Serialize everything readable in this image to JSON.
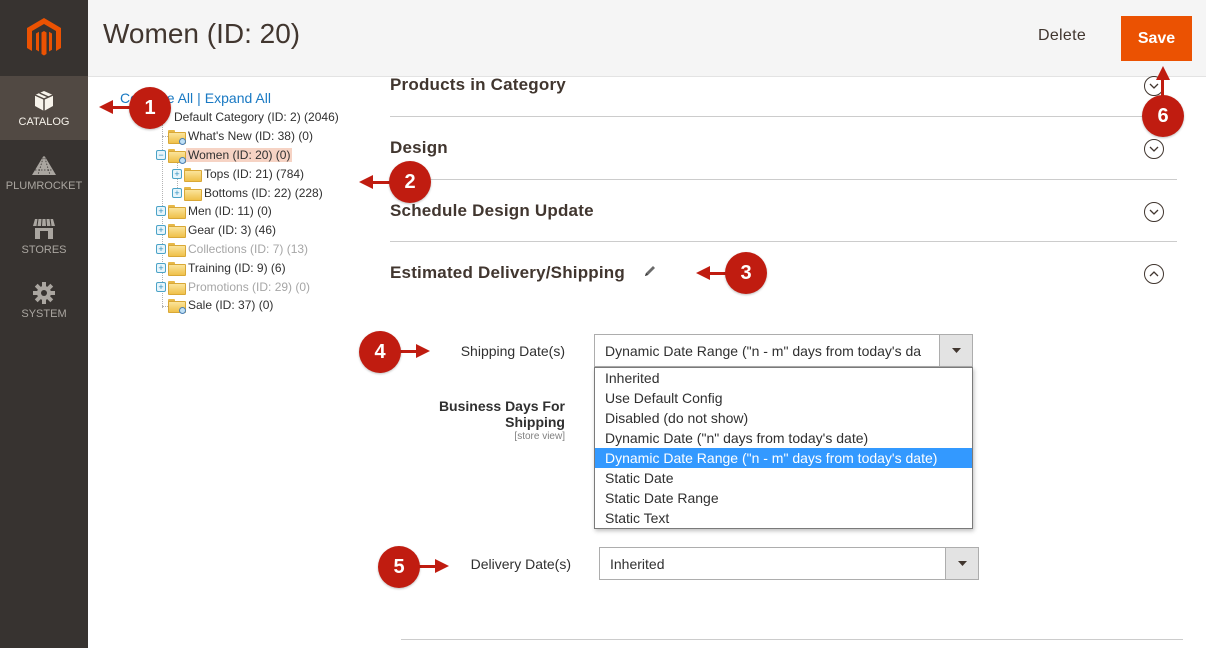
{
  "sidebar": {
    "logo": "magento-logo",
    "items": [
      {
        "label": "CATALOG",
        "icon": "cube-icon",
        "active": true
      },
      {
        "label": "PLUMROCKET",
        "icon": "pyramid-icon",
        "active": false
      },
      {
        "label": "STORES",
        "icon": "store-icon",
        "active": false
      },
      {
        "label": "SYSTEM",
        "icon": "gear-icon",
        "active": false
      }
    ]
  },
  "header": {
    "title": "Women (ID: 20)",
    "delete_label": "Delete",
    "save_label": "Save"
  },
  "tree": {
    "collapse_all": "Collapse All",
    "separator": "|",
    "expand_all": "Expand All",
    "nodes": [
      {
        "label": "Default Category (ID: 2) (2046)",
        "level": 0,
        "dim": false
      },
      {
        "label": "What's New (ID: 38) (0)",
        "level": 1,
        "dim": false
      },
      {
        "label": "Women (ID: 20) (0)",
        "level": 1,
        "dim": false,
        "selected": true,
        "expanded": true
      },
      {
        "label": "Tops (ID: 21) (784)",
        "level": 2,
        "dim": false
      },
      {
        "label": "Bottoms (ID: 22) (228)",
        "level": 2,
        "dim": false
      },
      {
        "label": "Men (ID: 11) (0)",
        "level": 1,
        "dim": false
      },
      {
        "label": "Gear (ID: 3) (46)",
        "level": 1,
        "dim": false
      },
      {
        "label": "Collections (ID: 7) (13)",
        "level": 1,
        "dim": true
      },
      {
        "label": "Training (ID: 9) (6)",
        "level": 1,
        "dim": false
      },
      {
        "label": "Promotions (ID: 29) (0)",
        "level": 1,
        "dim": true
      },
      {
        "label": "Sale (ID: 37) (0)",
        "level": 1,
        "dim": false
      }
    ]
  },
  "sections": [
    {
      "title": "Products in Category",
      "state": "collapsed"
    },
    {
      "title": "Design",
      "state": "collapsed"
    },
    {
      "title": "Schedule Design Update",
      "state": "collapsed"
    },
    {
      "title": "Estimated Delivery/Shipping",
      "state": "expanded"
    }
  ],
  "form": {
    "shipping_dates": {
      "label": "Shipping Date(s)",
      "value": "Dynamic Date Range (\"n - m\" days from today's da",
      "options": [
        "Inherited",
        "Use Default Config",
        "Disabled (do not show)",
        "Dynamic Date (\"n\" days from today's date)",
        "Dynamic Date Range (\"n - m\" days from today's date)",
        "Static Date",
        "Static Date Range",
        "Static Text"
      ],
      "selected_index": 4
    },
    "business_days": {
      "label_line1": "Business Days For",
      "label_line2": "Shipping",
      "scope": "[store view]"
    },
    "delivery_dates": {
      "label": "Delivery Date(s)",
      "value": "Inherited"
    }
  },
  "annotations": [
    "1",
    "2",
    "3",
    "4",
    "5",
    "6"
  ],
  "colors": {
    "accent": "#eb5202",
    "sidebar_bg": "#373330",
    "sidebar_active": "#514943",
    "annotation": "#c01c10",
    "selected_option": "#3399ff",
    "tree_selected": "#f6d3c4",
    "link": "#1979c3"
  }
}
